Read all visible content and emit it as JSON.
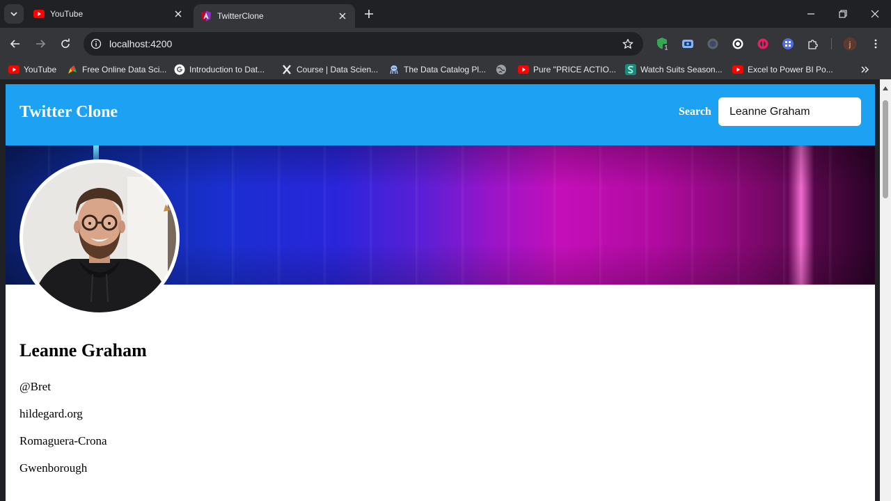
{
  "browser": {
    "tabs": [
      {
        "title": "YouTube",
        "icon": "youtube-icon",
        "active": false
      },
      {
        "title": "TwitterClone",
        "icon": "angular-icon",
        "active": true
      }
    ],
    "url": "localhost:4200",
    "profile_initial": "j",
    "extension_badge": "1",
    "bookmarks": [
      {
        "label": "YouTube",
        "icon": "youtube-icon"
      },
      {
        "label": "Free Online Data Sci...",
        "icon": "colorful-pencil-icon"
      },
      {
        "label": "Introduction to Dat...",
        "icon": "google-icon"
      },
      {
        "label": "Course | Data Scien...",
        "icon": "x-logo-icon"
      },
      {
        "label": "The Data Catalog Pl...",
        "icon": "octopus-icon"
      },
      {
        "label": "",
        "icon": "globe-icon"
      },
      {
        "label": "Pure \"PRICE ACTIO...",
        "icon": "youtube-icon"
      },
      {
        "label": "Watch Suits Season...",
        "icon": "s-logo-icon"
      },
      {
        "label": "Excel to Power BI Po...",
        "icon": "youtube-icon"
      }
    ]
  },
  "app": {
    "title": "Twitter Clone",
    "search_label": "Search",
    "search_value": "Leanne Graham"
  },
  "profile": {
    "name": "Leanne Graham",
    "username": "@Bret",
    "website": "hildegard.org",
    "company": "Romaguera-Crona",
    "city": "Gwenborough"
  },
  "colors": {
    "header": "#1da1f2",
    "chrome_dark": "#202124",
    "chrome_toolbar": "#35363a"
  }
}
